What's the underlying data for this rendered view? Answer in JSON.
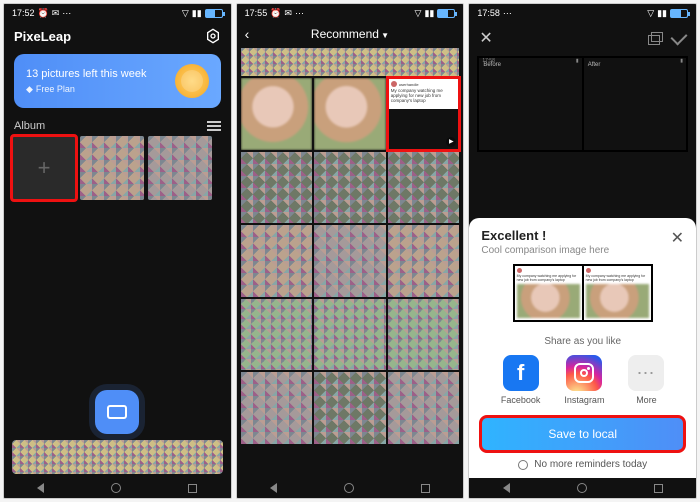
{
  "screen1": {
    "status_time": "17:52",
    "app_title": "PixeLeap",
    "banner_text": "13 pictures left this week",
    "plan_label": "Free Plan",
    "album_label": "Album"
  },
  "screen2": {
    "status_time": "17:55",
    "header_label": "Recommend",
    "meme_caption": "My company watching me applying for new job from company's laptop"
  },
  "screen3": {
    "status_time": "17:58",
    "before_label": "Before",
    "after_label": "After",
    "sheet_title": "Excellent !",
    "sheet_subtitle": "Cool comparison image here",
    "meme_caption": "My company watching me applying for new job from company's laptop",
    "share_label": "Share as you like",
    "share": {
      "facebook": "Facebook",
      "instagram": "Instagram",
      "more": "More"
    },
    "save_button": "Save to local",
    "reminder_label": "No more reminders today"
  }
}
